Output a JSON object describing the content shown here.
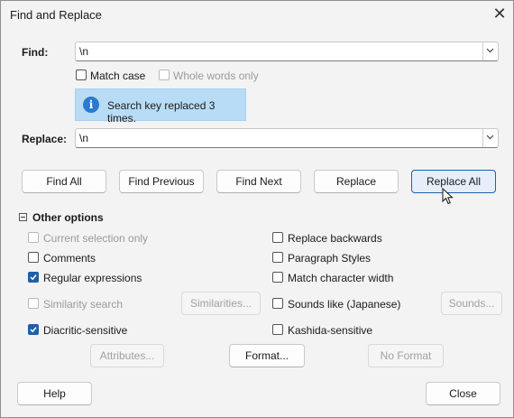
{
  "window": {
    "title": "Find and Replace"
  },
  "find": {
    "label": "Find:",
    "value": "\\n"
  },
  "match_case": {
    "label": "Match case",
    "checked": false
  },
  "whole_words": {
    "label": "Whole words only",
    "checked": false
  },
  "info": {
    "message": "Search key replaced 3 times."
  },
  "replace": {
    "label": "Replace:",
    "value": "\\n"
  },
  "buttons": {
    "find_all": "Find All",
    "find_previous": "Find Previous",
    "find_next": "Find Next",
    "replace": "Replace",
    "replace_all": "Replace All"
  },
  "other_options": {
    "title": "Other options",
    "current_selection_only": "Current selection only",
    "comments": "Comments",
    "regular_expressions": "Regular expressions",
    "similarity_search": "Similarity search",
    "similarities_button": "Similarities...",
    "diacritic_sensitive": "Diacritic-sensitive",
    "replace_backwards": "Replace backwards",
    "paragraph_styles": "Paragraph Styles",
    "match_character_width": "Match character width",
    "sounds_like": "Sounds like (Japanese)",
    "sounds_button": "Sounds...",
    "kashida_sensitive": "Kashida-sensitive",
    "attributes_button": "Attributes...",
    "format_button": "Format...",
    "no_format_button": "No Format"
  },
  "footer": {
    "help": "Help",
    "close": "Close"
  },
  "colors": {
    "accent": "#1f5fa8",
    "info_bg": "#b9dcf6",
    "info_icon": "#2a7bd0"
  }
}
